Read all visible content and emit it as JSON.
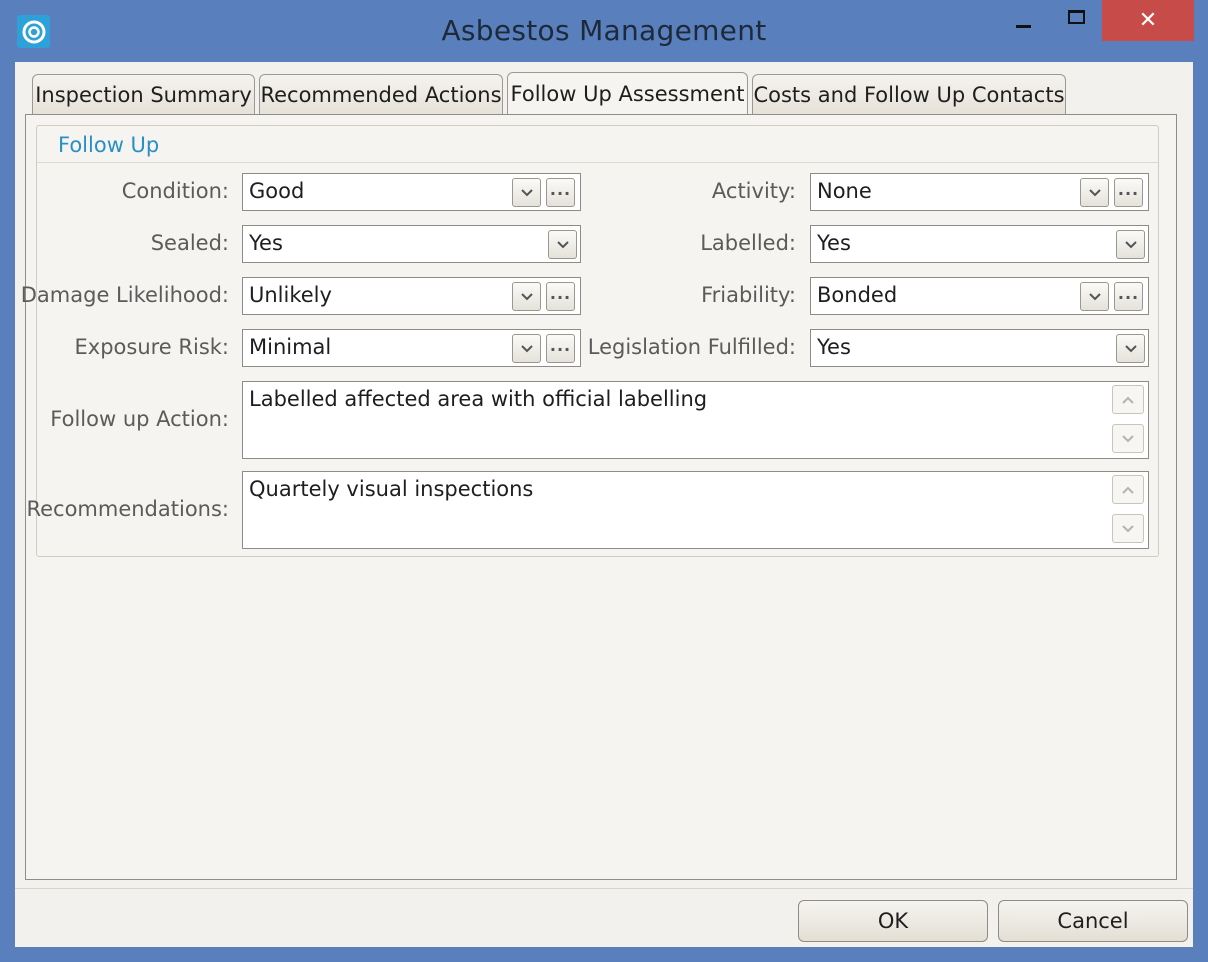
{
  "window": {
    "title": "Asbestos Management",
    "controls": {
      "minimize": "–",
      "maximize": "□",
      "close": "✕"
    }
  },
  "tabs": [
    {
      "label": "Inspection Summary",
      "active": false
    },
    {
      "label": "Recommended Actions",
      "active": false
    },
    {
      "label": "Follow Up Assessment",
      "active": true
    },
    {
      "label": "Costs and Follow Up Contacts",
      "active": false
    }
  ],
  "follow_up": {
    "title": "Follow Up",
    "condition": {
      "label": "Condition:",
      "value": "Good"
    },
    "sealed": {
      "label": "Sealed:",
      "value": "Yes"
    },
    "damage_likelihood": {
      "label": "Damage Likelihood:",
      "value": "Unlikely"
    },
    "exposure_risk": {
      "label": "Exposure Risk:",
      "value": "Minimal"
    },
    "activity": {
      "label": "Activity:",
      "value": "None"
    },
    "labelled": {
      "label": "Labelled:",
      "value": "Yes"
    },
    "friability": {
      "label": "Friability:",
      "value": "Bonded"
    },
    "legislation_fulfilled": {
      "label": "Legislation Fulfilled:",
      "value": "Yes"
    },
    "follow_up_action": {
      "label": "Follow up Action:",
      "value": "Labelled affected area with official labelling"
    },
    "recommendations": {
      "label": "Recommendations:",
      "value": "Quartely visual inspections"
    }
  },
  "buttons": {
    "ok": "OK",
    "cancel": "Cancel"
  },
  "colors": {
    "titlebar": "#5a7fbd",
    "close": "#c74c49",
    "group_title": "#2a8fc4"
  },
  "icons": [
    "app-logo-icon",
    "chevron-down-icon",
    "ellipsis-icon",
    "chevron-up-icon"
  ]
}
